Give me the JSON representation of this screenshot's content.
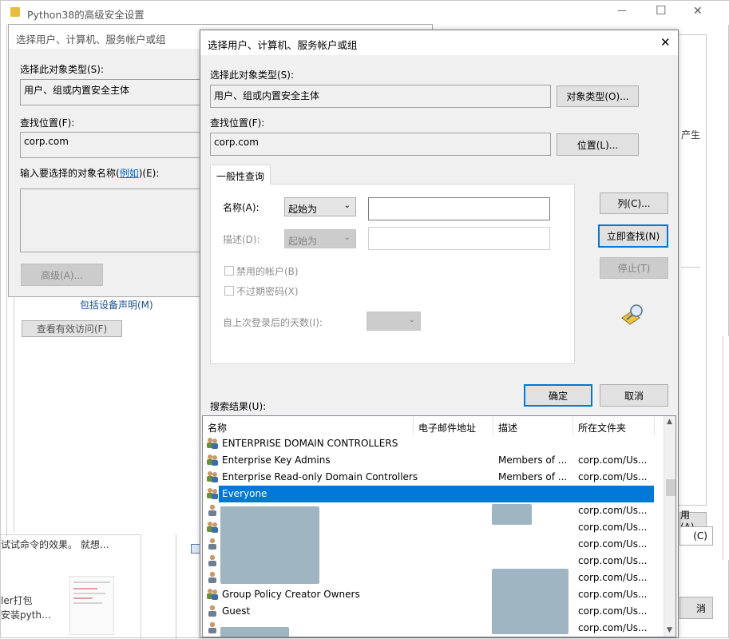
{
  "bg_window": {
    "title": "Python38的高级安全设置",
    "minimize": "—",
    "maximize": "☐",
    "close": "✕",
    "right_fragment": "产生",
    "left_link": "包括设备声明(M)",
    "view_access_button": "查看有效访问(F)",
    "bottom_text1": "试试命令的效果。 就想…",
    "bottom_text2": "ler打包",
    "bottom_text3": "安装pyth…",
    "right_btn_fragment1": "用(A)",
    "right_btn_fragment2": "(C)",
    "right_btn_fragment3": "消"
  },
  "back_dialog": {
    "title": "选择用户、计算机、服务帐户或组",
    "object_type_label": "选择此对象类型(S):",
    "object_type_value": "用户、组或内置安全主体",
    "location_label": "查找位置(F):",
    "location_value": "corp.com",
    "enter_names_prefix": "输入要选择的对象名称(",
    "enter_names_link": "例如",
    "enter_names_suffix": ")(E):",
    "advanced_button": "高级(A)..."
  },
  "dialog": {
    "title": "选择用户、计算机、服务帐户或组",
    "close": "✕",
    "object_type_label": "选择此对象类型(S):",
    "object_type_value": "用户、组或内置安全主体",
    "object_types_button": "对象类型(O)...",
    "location_label": "查找位置(F):",
    "location_value": "corp.com",
    "locations_button": "位置(L)...",
    "tab_common": "一般性查询",
    "name_label": "名称(A):",
    "name_combo": "起始为",
    "desc_label": "描述(D):",
    "desc_combo": "起始为",
    "disabled_accounts": "禁用的帐户(B)",
    "non_expiring": "不过期密码(X)",
    "days_since_label": "自上次登录后的天数(I):",
    "columns_button": "列(C)...",
    "find_now_button": "立即查找(N)",
    "stop_button": "停止(T)",
    "ok_button": "确定",
    "cancel_button": "取消",
    "results_label": "搜索结果(U):"
  },
  "results": {
    "columns": [
      "名称",
      "电子邮件地址",
      "描述",
      "所在文件夹"
    ],
    "rows": [
      {
        "name": "ENTERPRISE DOMAIN CONTROLLERS",
        "email": "",
        "desc": "",
        "folder": "",
        "icon": "group-icon"
      },
      {
        "name": "Enterprise Key Admins",
        "email": "",
        "desc": "Members of ...",
        "folder": "corp.com/Us...",
        "icon": "group-icon"
      },
      {
        "name": "Enterprise Read-only Domain Controllers",
        "email": "",
        "desc": "Members of ...",
        "folder": "corp.com/Us...",
        "icon": "group-icon"
      },
      {
        "name": "Everyone",
        "email": "",
        "desc": "",
        "folder": "",
        "icon": "group-icon",
        "selected": true
      },
      {
        "name": "",
        "email": "",
        "desc": "",
        "folder": "corp.com/Us...",
        "icon": "user-icon"
      },
      {
        "name": "",
        "email": "",
        "desc": "",
        "folder": "corp.com/Us...",
        "icon": "group-icon"
      },
      {
        "name": "",
        "email": "",
        "desc": "",
        "folder": "corp.com/Us...",
        "icon": "user-icon"
      },
      {
        "name": "",
        "email": "",
        "desc": "",
        "folder": "corp.com/Us...",
        "icon": "user-icon"
      },
      {
        "name": "",
        "email": "",
        "desc": "",
        "folder": "corp.com/Us...",
        "icon": "user-icon"
      },
      {
        "name": "Group Policy Creator Owners",
        "email": "",
        "desc": "",
        "folder": "corp.com/Us...",
        "icon": "group-icon"
      },
      {
        "name": "Guest",
        "email": "",
        "desc": "",
        "folder": "corp.com/Us...",
        "icon": "user-icon"
      },
      {
        "name": "",
        "email": "",
        "desc": "",
        "folder": "corp.com/Us...",
        "icon": "user-icon"
      }
    ]
  },
  "colors": {
    "selection": "#0078d7",
    "accent": "#0078d7",
    "redacted": "#9fb5c2"
  }
}
